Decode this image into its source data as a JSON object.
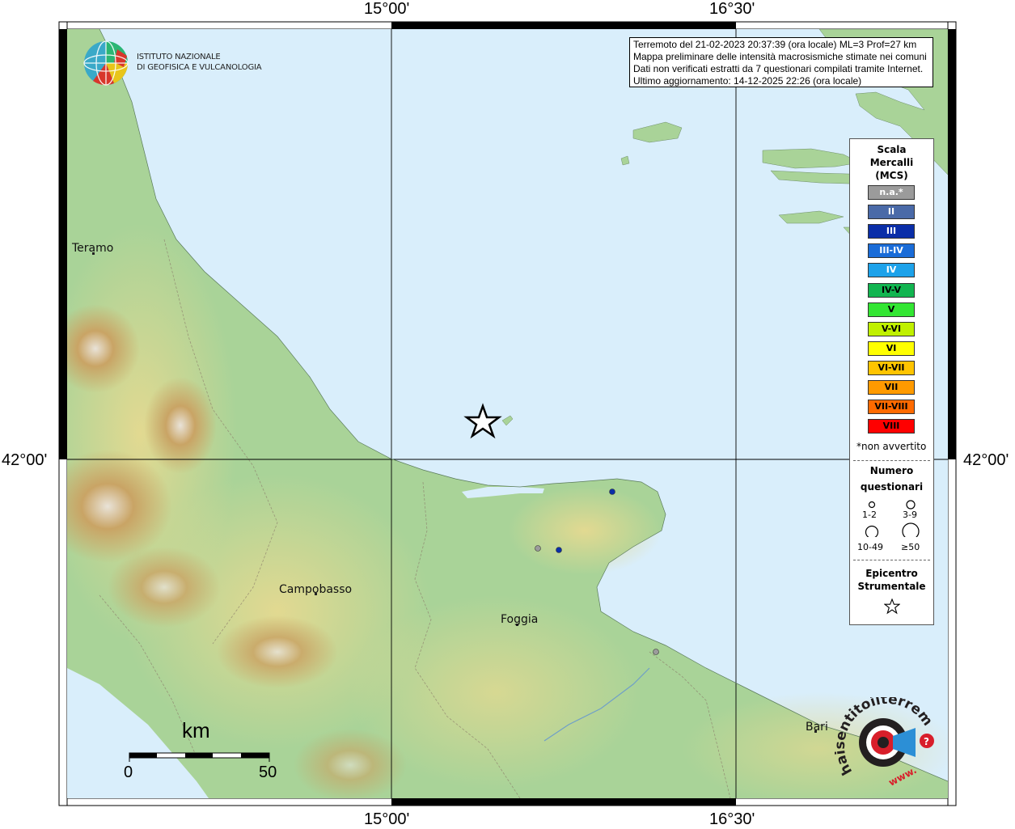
{
  "coords": {
    "top": [
      "15°00'",
      "16°30'"
    ],
    "bottom": [
      "15°00'",
      "16°30'"
    ],
    "left": "42°00'",
    "right": "42°00'"
  },
  "logo": {
    "line1": "ISTITUTO NAZIONALE",
    "line2": "DI GEOFISICA E VULCANOLOGIA"
  },
  "info": {
    "line1": "Terremoto del 21-02-2023 20:37:39 (ora locale) ML=3 Prof=27 km",
    "line2": "Mappa preliminare delle intensità macrosismiche stimate nei comuni",
    "line3": "Dati non verificati estratti da 7 questionari compilati tramite Internet.",
    "line4": "Ultimo aggiornamento: 14-12-2025 22:26 (ora locale)"
  },
  "legend": {
    "title1": "Scala",
    "title2": "Mercalli",
    "title3": "(MCS)",
    "scale": [
      {
        "label": "n.a.*",
        "color": "#9b9b9b"
      },
      {
        "label": "II",
        "color": "#4a6aa8"
      },
      {
        "label": "III",
        "color": "#0a2ea8"
      },
      {
        "label": "III-IV",
        "color": "#1a6cd8"
      },
      {
        "label": "IV",
        "color": "#1da2ea"
      },
      {
        "label": "IV-V",
        "color": "#12b550"
      },
      {
        "label": "V",
        "color": "#33e633"
      },
      {
        "label": "V-VI",
        "color": "#c0f000"
      },
      {
        "label": "VI",
        "color": "#ffff00"
      },
      {
        "label": "VI-VII",
        "color": "#ffc400"
      },
      {
        "label": "VII",
        "color": "#ff9a00"
      },
      {
        "label": "VII-VIII",
        "color": "#ff6a00"
      },
      {
        "label": "VIII",
        "color": "#ff0000"
      }
    ],
    "not_felt": "*non avvertito",
    "count_title1": "Numero",
    "count_title2": "questionari",
    "counts": [
      "1-2",
      "3-9",
      "10-49",
      "≥50"
    ],
    "epi_title1": "Epicentro",
    "epi_title2": "Strumentale"
  },
  "cities": {
    "teramo": "Teramo",
    "campobasso": "Campobasso",
    "foggia": "Foggia",
    "bari": "Bari"
  },
  "scalebar": {
    "unit": "km",
    "min": "0",
    "max": "50"
  },
  "watermark": {
    "text": "haisentitoilterremoto.it",
    "prefix": "www."
  },
  "colors": {
    "sea": "#d9eefb",
    "lowland": "#a9d398",
    "hill": "#d8d98c",
    "mountain": "#c09a5a"
  }
}
